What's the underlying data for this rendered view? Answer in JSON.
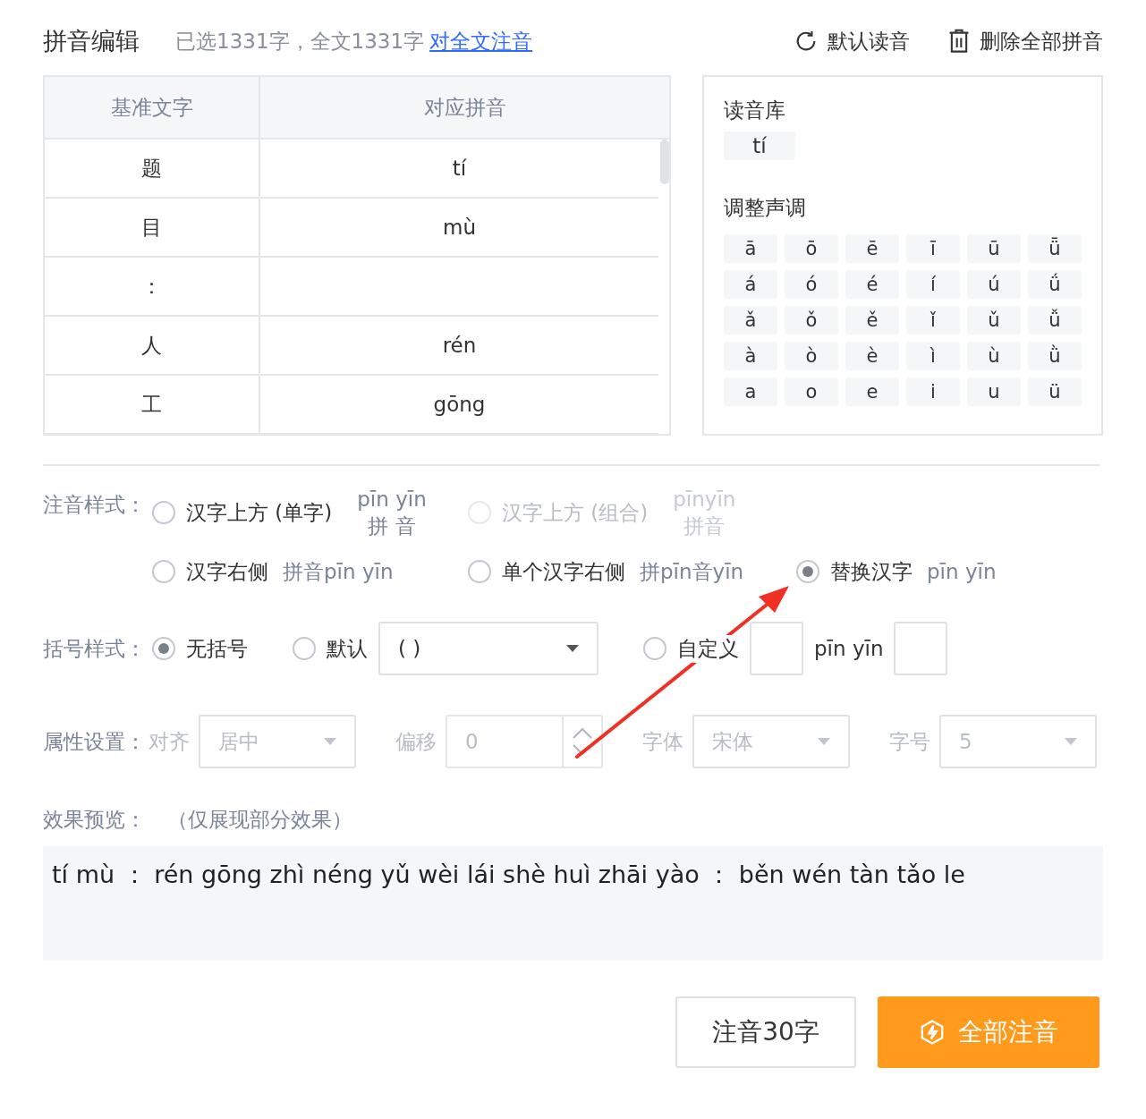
{
  "header": {
    "title": "拼音编辑",
    "info": "已选1331字，全文1331字",
    "link": "对全文注音",
    "actions": [
      {
        "label": "默认读音"
      },
      {
        "label": "删除全部拼音"
      }
    ]
  },
  "table": {
    "columns": [
      "基准文字",
      "对应拼音"
    ],
    "rows": [
      {
        "char": "题",
        "pinyin": "tí"
      },
      {
        "char": "目",
        "pinyin": "mù"
      },
      {
        "char": "："
      },
      {
        "char": "人",
        "pinyin": "rén"
      },
      {
        "char": "工",
        "pinyin": "gōng"
      }
    ]
  },
  "library": {
    "title": "读音库",
    "readings": [
      "tí"
    ],
    "tones_title": "调整声调",
    "tones": [
      [
        "ā",
        "ō",
        "ē",
        "ī",
        "ū",
        "ǖ"
      ],
      [
        "á",
        "ó",
        "é",
        "í",
        "ú",
        "ǘ"
      ],
      [
        "ǎ",
        "ǒ",
        "ě",
        "ǐ",
        "ǔ",
        "ǚ"
      ],
      [
        "à",
        "ò",
        "è",
        "ì",
        "ù",
        "ǜ"
      ],
      [
        "a",
        "o",
        "e",
        "i",
        "u",
        "ü"
      ]
    ]
  },
  "annotation_style": {
    "label": "注音样式：",
    "rows": [
      [
        {
          "kind": "stacked",
          "label": "汉字上方 (单字)",
          "ruby": "pīn yīn",
          "base": "拼 音",
          "selected": false,
          "disabled": false
        },
        {
          "kind": "stacked",
          "label": "汉字上方 (组合)",
          "ruby": "pīnyīn",
          "base": "拼音",
          "selected": false,
          "disabled": true
        }
      ],
      [
        {
          "kind": "inline",
          "label": "汉字右侧",
          "sample": "拼音pīn yīn",
          "selected": false,
          "disabled": false
        },
        {
          "kind": "inline",
          "label": "单个汉字右侧",
          "sample": "拼pīn音yīn",
          "selected": false,
          "disabled": false
        },
        {
          "kind": "inline",
          "label": "替换汉字",
          "sample": "pīn yīn",
          "selected": true,
          "disabled": false
        }
      ]
    ]
  },
  "bracket_style": {
    "label": "括号样式：",
    "options": [
      {
        "kind": "plain",
        "label": "无括号",
        "selected": true
      },
      {
        "kind": "select",
        "label": "默认",
        "value": "( )",
        "selected": false
      },
      {
        "kind": "custom",
        "label": "自定义",
        "middle": "pīn yīn",
        "selected": false
      }
    ]
  },
  "attributes": {
    "label": "属性设置：",
    "disabled": true,
    "fields": [
      {
        "kind": "select",
        "label": "对齐",
        "value": "居中"
      },
      {
        "kind": "spinner",
        "label": "偏移",
        "value": "0"
      },
      {
        "kind": "select",
        "label": "字体",
        "value": "宋体"
      },
      {
        "kind": "select",
        "label": "字号",
        "value": "5"
      }
    ]
  },
  "preview": {
    "label": "效果预览：",
    "note": "（仅展现部分效果）",
    "text": "tí mù ： rén gōng zhì néng yǔ wèi lái shè huì zhāi yào ： běn wén tàn tǎo le"
  },
  "buttons": [
    {
      "kind": "secondary",
      "label": "注音30字"
    },
    {
      "kind": "primary",
      "label": "全部注音"
    }
  ]
}
